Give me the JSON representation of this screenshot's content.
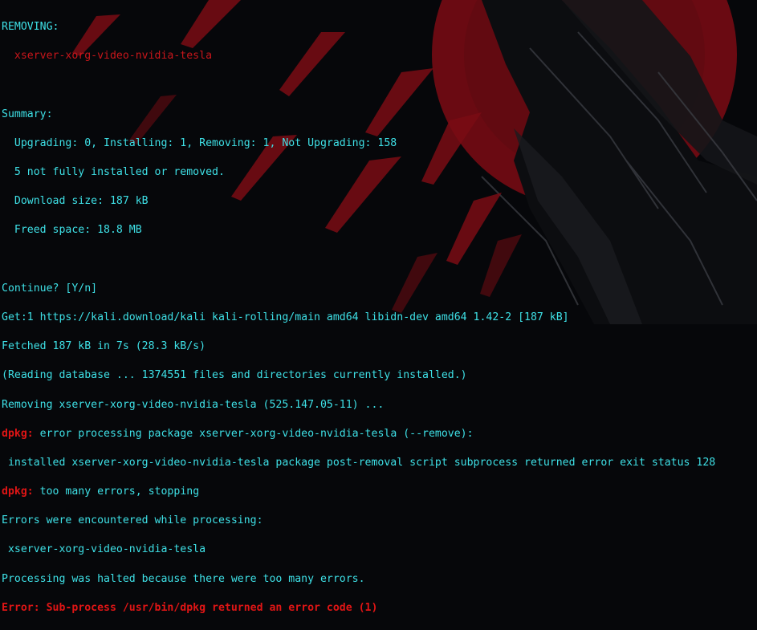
{
  "terminal": {
    "removing_header": "REMOVING:",
    "removing_pkg": "  xserver-xorg-video-nvidia-tesla",
    "summary_header": "Summary:",
    "summary_lines": [
      "  Upgrading: 0, Installing: 1, Removing: 1, Not Upgrading: 158",
      "  5 not fully installed or removed.",
      "  Download size: 187 kB",
      "  Freed space: 18.8 MB"
    ],
    "continue_prompt": "Continue? [Y/n]",
    "get_line": "Get:1 https://kali.download/kali kali-rolling/main amd64 libidn-dev amd64 1.42-2 [187 kB]",
    "fetched_line": "Fetched 187 kB in 7s (28.3 kB/s)",
    "reading_db_line": "(Reading database ... 1374551 files and directories currently installed.)",
    "removing_line": "Removing xserver-xorg-video-nvidia-tesla (525.147.05-11) ...",
    "dpkg_label": "dpkg:",
    "dpkg_error_1": " error processing package xserver-xorg-video-nvidia-tesla (--remove):",
    "installed_line": " installed xserver-xorg-video-nvidia-tesla package post-removal script subprocess returned error exit status 128",
    "dpkg_error_2": " too many errors, stopping",
    "errors_encountered": "Errors were encountered while processing:",
    "errors_pkg": " xserver-xorg-video-nvidia-tesla",
    "halted_line": "Processing was halted because there were too many errors.",
    "final_error": "Error: Sub-process /usr/bin/dpkg returned an error code (1)"
  },
  "colors": {
    "text_cyan": "#3ee0e6",
    "error_red": "#d41a1a",
    "background": "#06070a"
  }
}
